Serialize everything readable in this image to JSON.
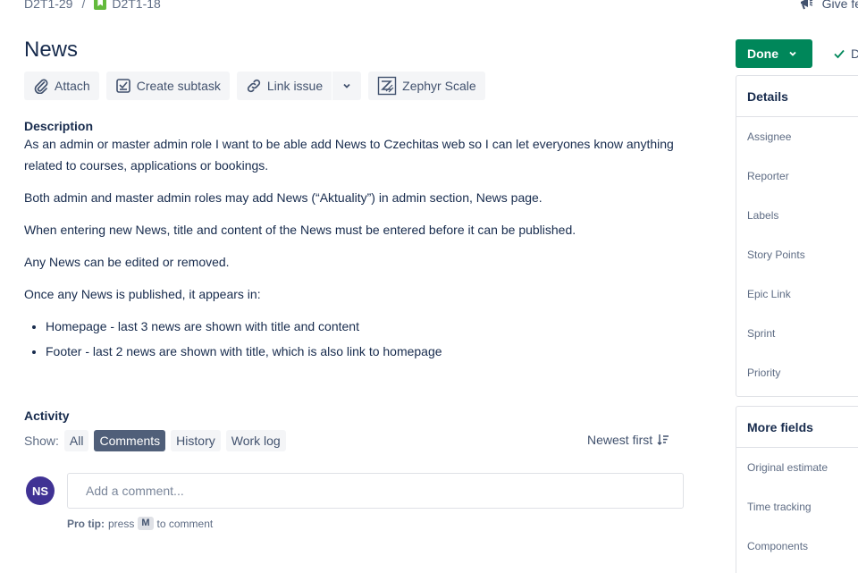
{
  "breadcrumb": {
    "parent": "D2T1-29",
    "separator": "/",
    "current": "D2T1-18"
  },
  "feedback_label": "Give fe",
  "issue": {
    "title": "News"
  },
  "toolbar": {
    "attach": "Attach",
    "create_subtask": "Create subtask",
    "link_issue": "Link issue",
    "zephyr": "Zephyr Scale"
  },
  "description": {
    "label": "Description",
    "p1": "As an admin or master admin role I want to be able add News to Czechitas web so I can let everyones know anything related to courses, applications or bookings.",
    "p2": "Both admin and master admin roles may add News (“Aktuality”) in admin section, News page.",
    "p3": "When entering new News, title and content of the News must be entered before it can be published.",
    "p4": "Any News can be edited or removed.",
    "p5": "Once any News is published, it appears in:",
    "bullets": [
      "Homepage - last 3 news are shown with title and content",
      "Footer - last 2 news are shown with title, which is also link to homepage"
    ]
  },
  "activity": {
    "label": "Activity",
    "show_label": "Show:",
    "filters": [
      "All",
      "Comments",
      "History",
      "Work log"
    ],
    "active_filter": "Comments",
    "sort_label": "Newest first"
  },
  "comment": {
    "avatar_initials": "NS",
    "placeholder": "Add a comment...",
    "tip_prefix": "Pro tip:",
    "tip_press": "press",
    "tip_key": "M",
    "tip_suffix": "to comment"
  },
  "status": {
    "button_label": "Done",
    "resolution_label": "D"
  },
  "details": {
    "title": "Details",
    "fields": [
      "Assignee",
      "Reporter",
      "Labels",
      "Story Points",
      "Epic Link",
      "Sprint",
      "Priority"
    ]
  },
  "more_fields": {
    "title": "More fields",
    "fields": [
      "Original estimate",
      "Time tracking",
      "Components"
    ]
  },
  "colors": {
    "done_green": "#00875a",
    "avatar_purple": "#403294",
    "story_green": "#63ba3c",
    "active_pill": "#505f79"
  }
}
